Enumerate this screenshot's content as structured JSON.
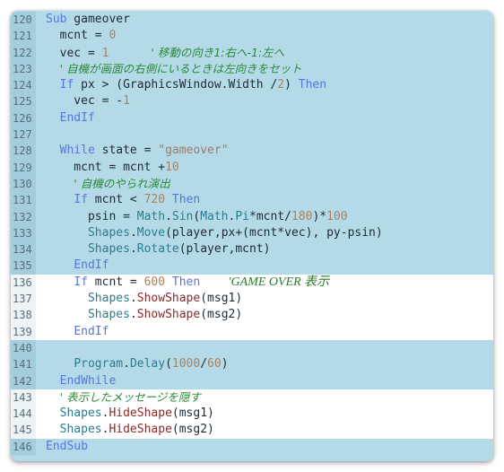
{
  "editor": {
    "language": "Small Basic",
    "colors": {
      "highlight_bg": "#b4dae8",
      "plain_bg": "#ffffff",
      "keyword": "#5577dd",
      "number": "#a9815f",
      "string": "#9b7b68",
      "comment": "#2b8a3a",
      "class": "#2b7c8c",
      "method_shape_visibility": "#8a2a2a"
    },
    "lines": [
      {
        "n": "120",
        "hl": true,
        "tokens": [
          [
            "kw",
            "Sub"
          ],
          [
            "op",
            " gameover"
          ]
        ]
      },
      {
        "n": "121",
        "hl": true,
        "tokens": [
          [
            "op",
            "  mcnt = "
          ],
          [
            "num",
            "0"
          ]
        ]
      },
      {
        "n": "122",
        "hl": true,
        "tokens": [
          [
            "op",
            "  vec = "
          ],
          [
            "num",
            "1"
          ],
          [
            "op",
            "      "
          ],
          [
            "cmt",
            "' 移動の向き1:右へ-1:左へ"
          ]
        ]
      },
      {
        "n": "123",
        "hl": true,
        "tokens": [
          [
            "op",
            "  "
          ],
          [
            "cmt",
            "' 自機が画面の右側にいるときは左向きをセット"
          ]
        ]
      },
      {
        "n": "124",
        "hl": true,
        "tokens": [
          [
            "op",
            "  "
          ],
          [
            "kw",
            "If"
          ],
          [
            "op",
            " px > (GraphicsWindow.Width /"
          ],
          [
            "num",
            "2"
          ],
          [
            "op",
            ") "
          ],
          [
            "kw",
            "Then"
          ]
        ]
      },
      {
        "n": "125",
        "hl": true,
        "tokens": [
          [
            "op",
            "    vec = -"
          ],
          [
            "num",
            "1"
          ]
        ]
      },
      {
        "n": "126",
        "hl": true,
        "tokens": [
          [
            "op",
            "  "
          ],
          [
            "kw",
            "EndIf"
          ]
        ]
      },
      {
        "n": "127",
        "hl": true,
        "tokens": []
      },
      {
        "n": "128",
        "hl": true,
        "tokens": [
          [
            "op",
            "  "
          ],
          [
            "kw",
            "While"
          ],
          [
            "op",
            " state = "
          ],
          [
            "str",
            "\"gameover\""
          ]
        ]
      },
      {
        "n": "129",
        "hl": true,
        "tokens": [
          [
            "op",
            "    mcnt = mcnt +"
          ],
          [
            "num",
            "10"
          ]
        ]
      },
      {
        "n": "130",
        "hl": true,
        "tokens": [
          [
            "op",
            "    "
          ],
          [
            "cmt",
            "' 自機のやられ演出"
          ]
        ]
      },
      {
        "n": "131",
        "hl": true,
        "tokens": [
          [
            "op",
            "    "
          ],
          [
            "kw",
            "If"
          ],
          [
            "op",
            " mcnt < "
          ],
          [
            "num",
            "720"
          ],
          [
            "op",
            " "
          ],
          [
            "kw",
            "Then"
          ]
        ]
      },
      {
        "n": "132",
        "hl": true,
        "tokens": [
          [
            "op",
            "      psin = "
          ],
          [
            "cls",
            "Math"
          ],
          [
            "op",
            "."
          ],
          [
            "mth",
            "Sin"
          ],
          [
            "op",
            "("
          ],
          [
            "cls",
            "Math"
          ],
          [
            "op",
            "."
          ],
          [
            "mth",
            "Pi"
          ],
          [
            "op",
            "*mcnt/"
          ],
          [
            "num",
            "180"
          ],
          [
            "op",
            ")*"
          ],
          [
            "num",
            "100"
          ]
        ]
      },
      {
        "n": "133",
        "hl": true,
        "tokens": [
          [
            "op",
            "      "
          ],
          [
            "cls",
            "Shapes"
          ],
          [
            "op",
            "."
          ],
          [
            "mth",
            "Move"
          ],
          [
            "op",
            "(player,px+(mcnt*vec), py-psin)"
          ]
        ]
      },
      {
        "n": "134",
        "hl": true,
        "tokens": [
          [
            "op",
            "      "
          ],
          [
            "cls",
            "Shapes"
          ],
          [
            "op",
            "."
          ],
          [
            "mth",
            "Rotate"
          ],
          [
            "op",
            "(player,mcnt)"
          ]
        ]
      },
      {
        "n": "135",
        "hl": true,
        "tokens": [
          [
            "op",
            "    "
          ],
          [
            "kw",
            "EndIf"
          ]
        ]
      },
      {
        "n": "136",
        "hl": false,
        "tokens": [
          [
            "op",
            "    "
          ],
          [
            "kw",
            "If"
          ],
          [
            "op",
            " mcnt = "
          ],
          [
            "num",
            "600"
          ],
          [
            "op",
            " "
          ],
          [
            "kw",
            "Then"
          ],
          [
            "op",
            "    "
          ],
          [
            "cmt-serif",
            "'GAME OVER 表示"
          ]
        ]
      },
      {
        "n": "137",
        "hl": false,
        "tokens": [
          [
            "op",
            "      "
          ],
          [
            "cls",
            "Shapes"
          ],
          [
            "op",
            "."
          ],
          [
            "mth2",
            "ShowShape"
          ],
          [
            "op",
            "(msg1)"
          ]
        ]
      },
      {
        "n": "138",
        "hl": false,
        "tokens": [
          [
            "op",
            "      "
          ],
          [
            "cls",
            "Shapes"
          ],
          [
            "op",
            "."
          ],
          [
            "mth2",
            "ShowShape"
          ],
          [
            "op",
            "(msg2)"
          ]
        ]
      },
      {
        "n": "139",
        "hl": false,
        "tokens": [
          [
            "op",
            "    "
          ],
          [
            "kw",
            "EndIf"
          ]
        ]
      },
      {
        "n": "140",
        "hl": true,
        "tokens": []
      },
      {
        "n": "141",
        "hl": true,
        "tokens": [
          [
            "op",
            "    "
          ],
          [
            "cls",
            "Program"
          ],
          [
            "op",
            "."
          ],
          [
            "mth",
            "Delay"
          ],
          [
            "op",
            "("
          ],
          [
            "num",
            "1000"
          ],
          [
            "op",
            "/"
          ],
          [
            "num",
            "60"
          ],
          [
            "op",
            ")"
          ]
        ]
      },
      {
        "n": "142",
        "hl": true,
        "tokens": [
          [
            "op",
            "  "
          ],
          [
            "kw",
            "EndWhile"
          ]
        ]
      },
      {
        "n": "143",
        "hl": false,
        "tokens": [
          [
            "op",
            "  "
          ],
          [
            "cmt",
            "' 表示したメッセージを隠す"
          ]
        ]
      },
      {
        "n": "144",
        "hl": false,
        "tokens": [
          [
            "op",
            "  "
          ],
          [
            "cls",
            "Shapes"
          ],
          [
            "op",
            "."
          ],
          [
            "mth2",
            "HideShape"
          ],
          [
            "op",
            "(msg1)"
          ]
        ]
      },
      {
        "n": "145",
        "hl": false,
        "tokens": [
          [
            "op",
            "  "
          ],
          [
            "cls",
            "Shapes"
          ],
          [
            "op",
            "."
          ],
          [
            "mth2",
            "HideShape"
          ],
          [
            "op",
            "(msg2)"
          ]
        ]
      },
      {
        "n": "146",
        "hl": true,
        "tokens": [
          [
            "kw",
            "EndSub"
          ]
        ]
      }
    ]
  }
}
